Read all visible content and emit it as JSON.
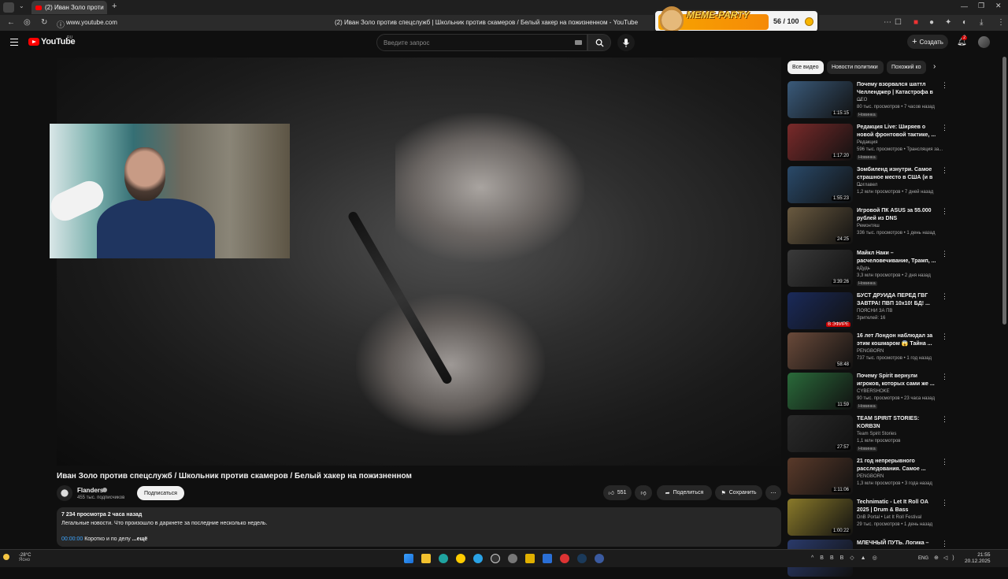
{
  "browser": {
    "tab_title": "(2) Иван Золо проти",
    "url": "www.youtube.com",
    "page_title": "(2) Иван Золо против спецслужб | Школьник против скамеров / Белый хакер на пожизненном - YouTube"
  },
  "meme_widget": {
    "title": "MEME-PARTY",
    "score": "56 / 100"
  },
  "header": {
    "logo": "YouTube",
    "region": "RU",
    "search_placeholder": "Введите запрос",
    "create_label": "Создать",
    "notif_count": "2"
  },
  "video": {
    "title": "Иван Золо против спецслужб / Школьник против скамеров / Белый хакер на пожизненном",
    "channel": "Flanders",
    "subscribers": "455 тыс. подписчиков",
    "subscribe_label": "Подписаться",
    "likes": "551",
    "share_label": "Поделиться",
    "save_label": "Сохранить",
    "views_line": "7 234 просмотра  2 часа назад",
    "desc_line": "Легальные новости. Что произошло в даркнете за последние несколько недель.",
    "timestamp": "00:00:00",
    "desc_tail": "Коротко и по делу",
    "more": "...ещё"
  },
  "chips": [
    "Все видео",
    "Новости политики",
    "Похожий ко"
  ],
  "recommendations": [
    {
      "title": "Почему взорвался шаттл Челленджер | Катастрофа в ...",
      "channel": "GEO",
      "meta": "80 тыс. просмотров • 7 часов назад",
      "badge": "Новинка",
      "duration": "1:15:15",
      "thumb": "#3a5a7a"
    },
    {
      "title": "Редакция Live: Ширяев о новой фронтовой тактике, ...",
      "channel": "Редакция",
      "meta": "596 тыс. просмотров • Трансляция за...",
      "badge": "Новинка",
      "duration": "1:17:20",
      "thumb": "#7a2a2a"
    },
    {
      "title": "Зомбиленд изнутри. Самое страшное место в США (и в ...",
      "channel": "Поглавел",
      "meta": "1,2 млн просмотров • 7 дней назад",
      "badge": "",
      "duration": "1:55:23",
      "thumb": "#2a4a6a"
    },
    {
      "title": "Игровой ПК ASUS за 55.000 рублей из DNS",
      "channel": "Ремонтяш",
      "meta": "336 тыс. просмотров • 1 день назад",
      "badge": "",
      "duration": "24:25",
      "thumb": "#6a5a40"
    },
    {
      "title": "Майкл Наки – расчеловечивание, Трамп, ...",
      "channel": "вДудь",
      "meta": "3,3 млн просмотров • 2 дня назад",
      "badge": "Новинка",
      "duration": "3:39:26",
      "thumb": "#3a3a3a"
    },
    {
      "title": "БУСТ ДРУИДА ПЕРЕД ГВГ ЗАВТРА! ПВП 10х10! БД! ...",
      "channel": "ПОЯСНИ ЗА ПВ",
      "meta": "Зрителей: 16",
      "badge": "",
      "duration": "",
      "live": "В ЭФИРЕ",
      "thumb": "#1a2a5a"
    },
    {
      "title": "16 лет Лондон наблюдал за этим кошмаром 😱 Тайна ...",
      "channel": "PENGBORN",
      "meta": "737 тыс. просмотров • 1 год назад",
      "badge": "",
      "duration": "58:48",
      "thumb": "#6a4a3a"
    },
    {
      "title": "Почему Spirit вернули игроков, которых сами же ...",
      "channel": "CYBERSHOKE",
      "meta": "90 тыс. просмотров • 23 часа назад",
      "badge": "Новинка",
      "duration": "11:59",
      "thumb": "#2a6a3a"
    },
    {
      "title": "TEAM SPIRIT STORIES: KORB3N",
      "channel": "Team Spirit Stories",
      "meta": "1,1 млн просмотров",
      "badge": "Новинка",
      "duration": "27:57",
      "thumb": "#2a2a2a"
    },
    {
      "title": "21 год непрерывного расследования. Самое ...",
      "channel": "PENGBORN",
      "meta": "1,3 млн просмотров • 3 года назад",
      "badge": "",
      "duration": "1:11:06",
      "thumb": "#5a3a2a"
    },
    {
      "title": "Technimatic - Let It Roll OA 2025 | Drum & Bass",
      "channel": "DnB Portal • Let It Roll Festival",
      "meta": "29 тыс. просмотров • 1 день назад",
      "badge": "",
      "duration": "1:00:22",
      "thumb": "#8a7a2a"
    },
    {
      "title": "МЛЕЧНЫЙ ПУТЬ. Логика –",
      "channel": "",
      "meta": "",
      "badge": "",
      "duration": "",
      "thumb": "#2a3a6a"
    }
  ],
  "taskbar": {
    "temp": "-28°C",
    "weather": "Ясно",
    "lang": "ENG",
    "time": "21:55",
    "date": "20.12.2025"
  }
}
